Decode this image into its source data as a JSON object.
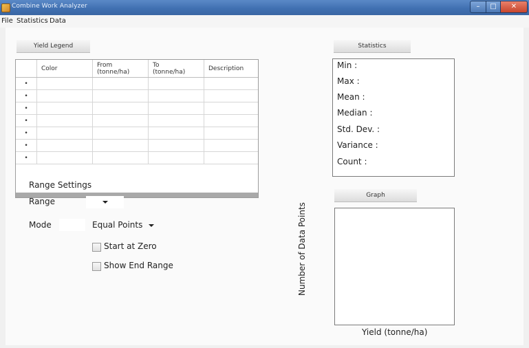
{
  "window": {
    "title": "Combine Work Analyzer",
    "minimize": "–",
    "maximize": "□",
    "close": "✕"
  },
  "menu": [
    "File",
    "Statistics",
    "Data"
  ],
  "legend": {
    "button": "Yield Legend",
    "columns": [
      "Color",
      "From\n(tonne/ha)",
      "To\n(tonne/ha)",
      "Description"
    ],
    "row_marker": "•",
    "row_count": 7
  },
  "range_settings": {
    "heading": "Range Settings",
    "range_label": "Range",
    "range_value": "",
    "mode_label": "Mode",
    "mode_value": "Equal Points",
    "start_at_zero": {
      "label": "Start at Zero",
      "checked": false
    },
    "show_end_range": {
      "label": "Show End Range",
      "checked": false
    }
  },
  "statistics": {
    "button": "Statistics",
    "items": [
      "Min :",
      "Max :",
      "Mean :",
      "Median :",
      "Std. Dev. :",
      "Variance :",
      "Count :"
    ]
  },
  "graph": {
    "button": "Graph",
    "ylabel": "Number of Data Points",
    "xlabel": "Yield (tonne/ha)"
  }
}
